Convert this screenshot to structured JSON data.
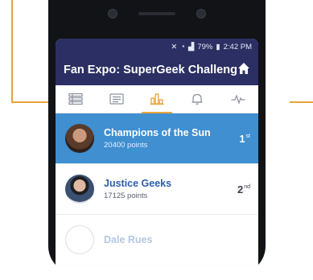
{
  "status_bar": {
    "battery": "79%",
    "time": "2:42 PM"
  },
  "app_bar": {
    "title": "Fan Expo: SuperGeek Challeng...",
    "home_icon": "home-icon"
  },
  "tabs": [
    {
      "icon": "list-icon",
      "active": false
    },
    {
      "icon": "newspaper-icon",
      "active": false
    },
    {
      "icon": "leaderboard-icon",
      "active": true
    },
    {
      "icon": "bell-icon",
      "active": false
    },
    {
      "icon": "activity-icon",
      "active": false
    }
  ],
  "leaderboard": [
    {
      "name": "Champions of the Sun",
      "points": "20400 points",
      "rank": "1",
      "suffix": "st",
      "highlight": true
    },
    {
      "name": "Justice Geeks",
      "points": "17125 points",
      "rank": "2",
      "suffix": "nd",
      "highlight": false
    },
    {
      "name": "Dale Rues",
      "points": "",
      "rank": "",
      "suffix": "",
      "highlight": false,
      "faded": true
    }
  ],
  "colors": {
    "app_bar": "#2b2f63",
    "highlight_row": "#3f8fd1",
    "accent": "#e8a33a"
  }
}
